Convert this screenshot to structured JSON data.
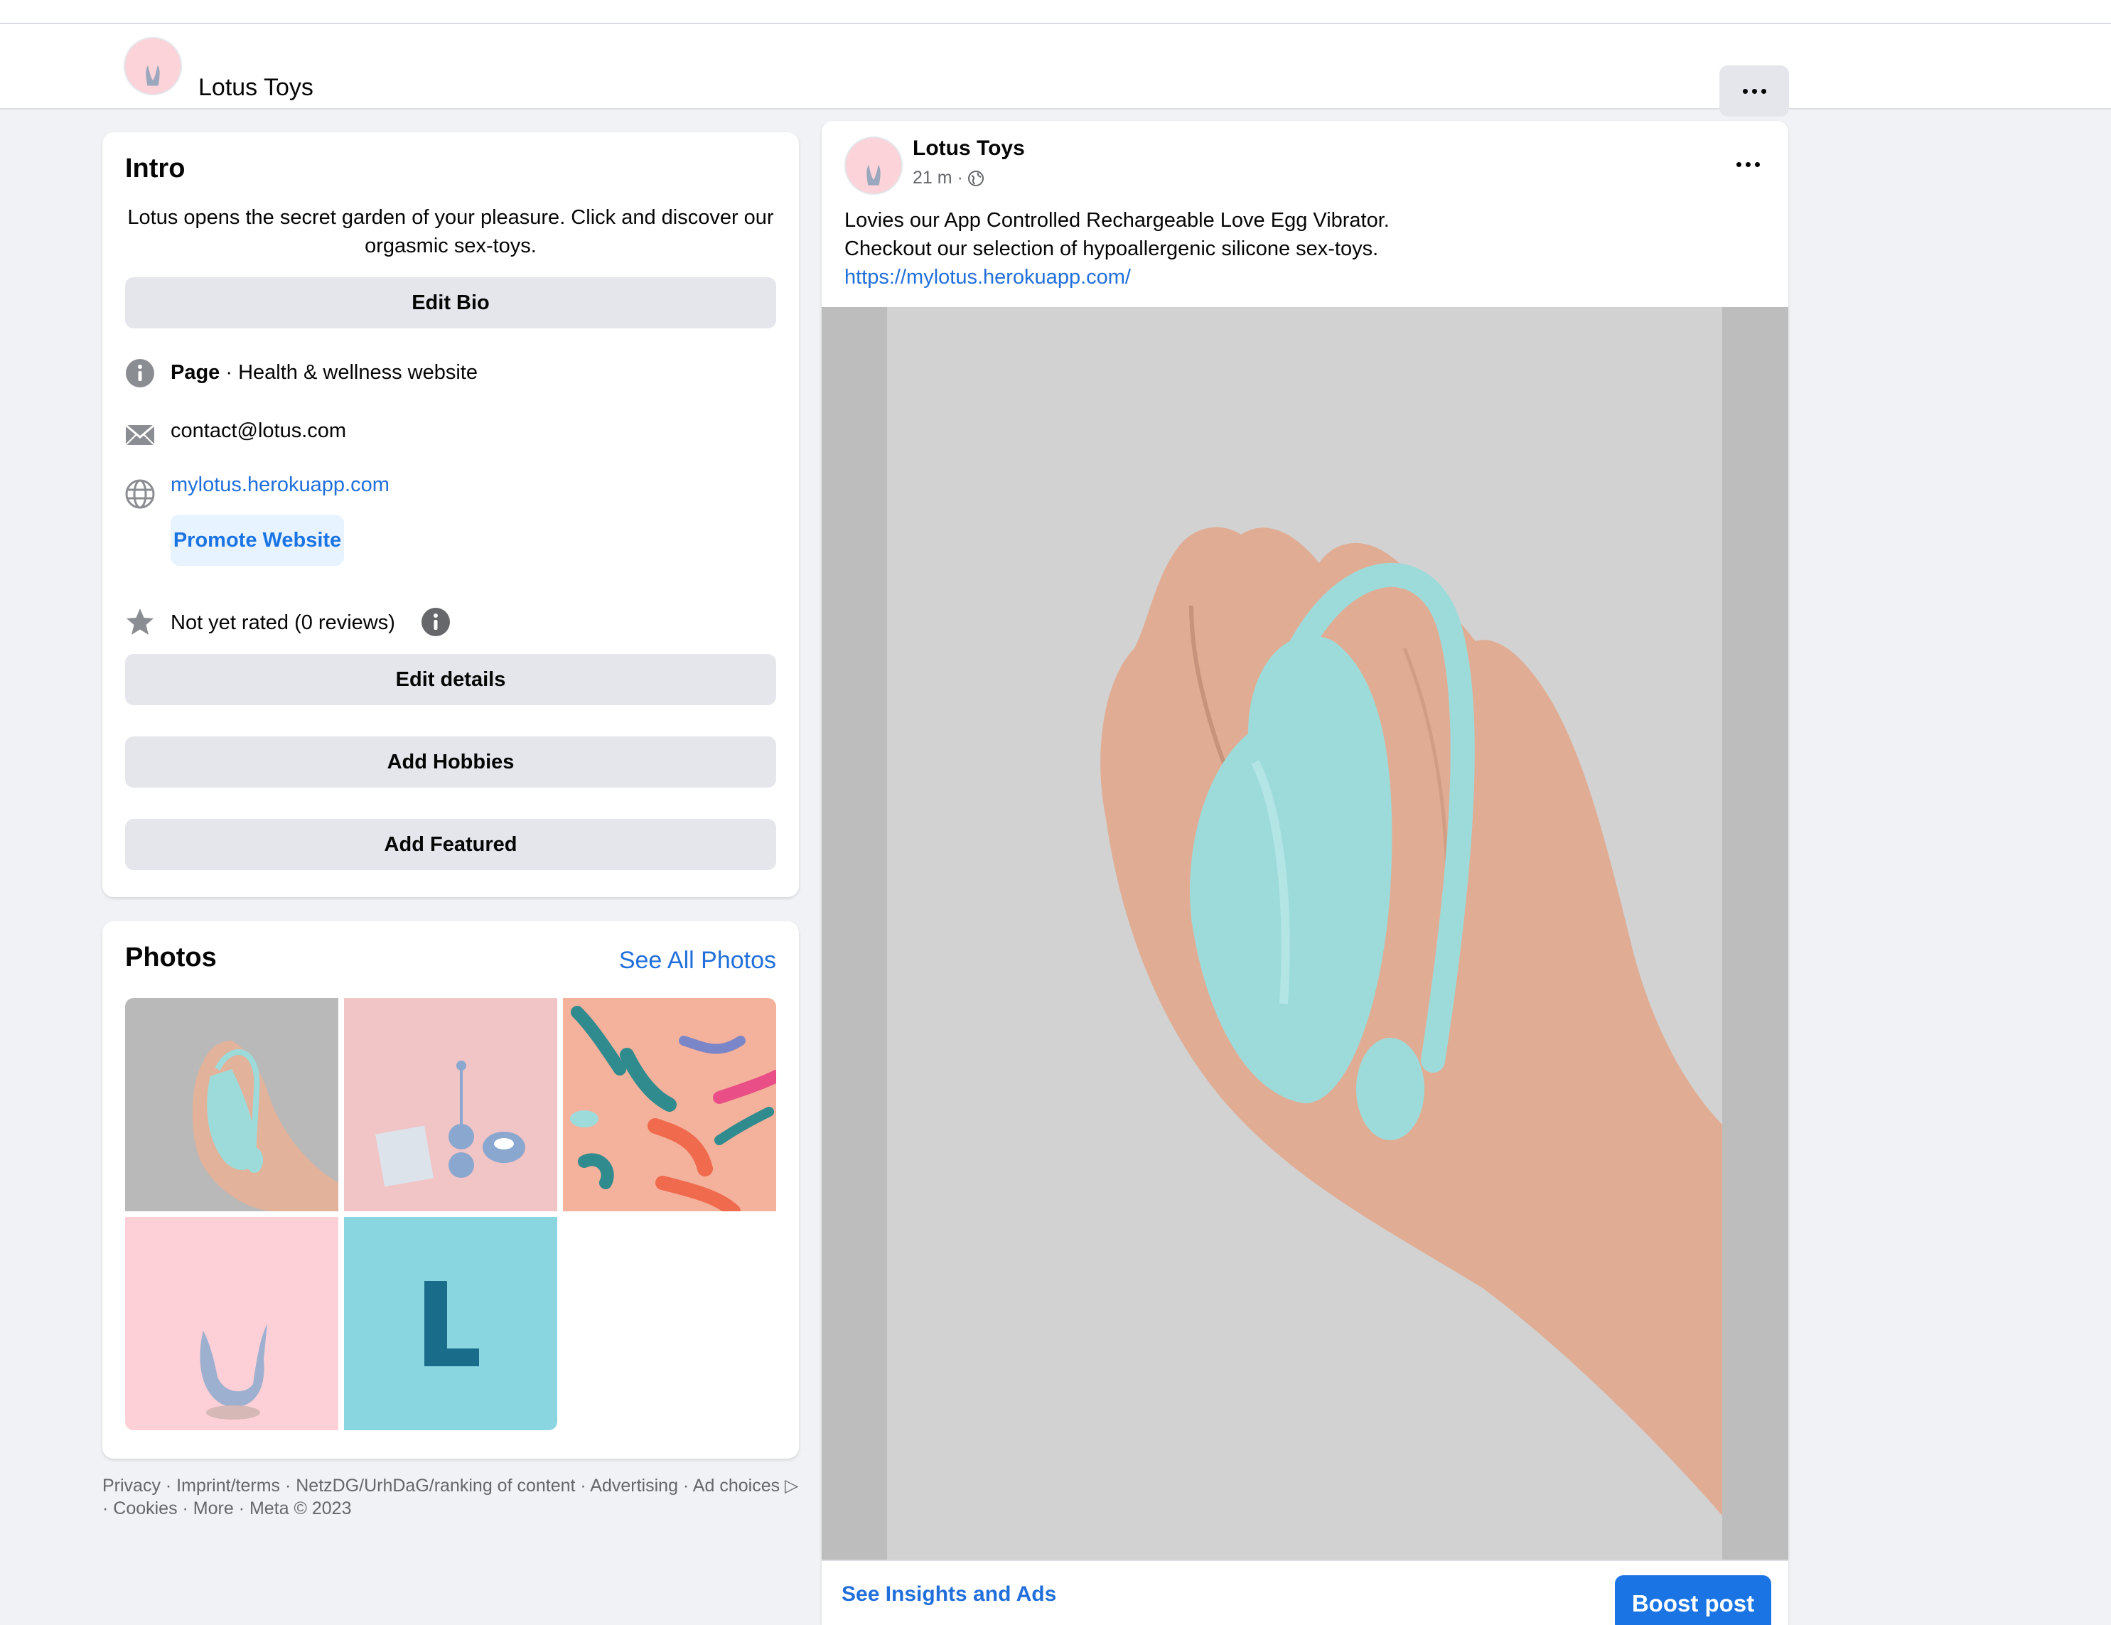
{
  "header": {
    "page_name": "Lotus Toys",
    "more_icon": "more-horizontal-icon"
  },
  "intro": {
    "title": "Intro",
    "bio": "Lotus opens the secret garden of your pleasure. Click and discover our orgasmic sex-toys.",
    "edit_bio_label": "Edit Bio",
    "category_bold": "Page",
    "category_rest": " · Health & wellness website",
    "email": "contact@lotus.com",
    "website": "mylotus.herokuapp.com",
    "promote_label": "Promote Website",
    "rating": "Not yet rated (0 reviews)",
    "edit_details_label": "Edit details",
    "add_hobbies_label": "Add Hobbies",
    "add_featured_label": "Add Featured"
  },
  "photos": {
    "title": "Photos",
    "see_all_label": "See All Photos",
    "thumbs": [
      "hand-holding-egg-photo",
      "pink-toys-note-photo",
      "coral-toys-flatlay-photo",
      "u-shaped-toy-photo",
      "l-logo-photo"
    ]
  },
  "footer": {
    "text": "Privacy · Imprint/terms · NetzDG/UrhDaG/ranking of content · Advertising · Ad choices ▷ · Cookies · More · Meta © 2023"
  },
  "post": {
    "author": "Lotus Toys",
    "time": "21 m ·",
    "line1": "Lovies our App Controlled Rechargeable Love Egg Vibrator.",
    "line2": "Checkout our selection of hypoallergenic silicone sex-toys.",
    "url": "https://mylotus.herokuapp.com/",
    "insights_label": "See Insights and Ads",
    "boost_label": "Boost post"
  },
  "colors": {
    "link": "#216fdb",
    "primary": "#1b74e4",
    "button_gray": "#e4e6eb",
    "background": "#f0f2f5",
    "brand_pink": "#fbd3d8",
    "toy_mint": "#9ddbdb"
  }
}
